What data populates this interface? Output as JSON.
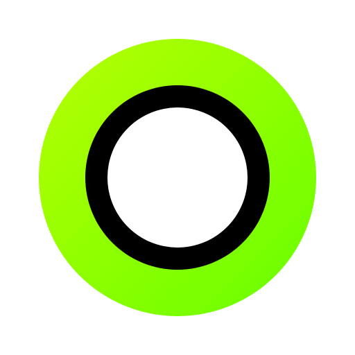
{
  "logo": {
    "icon": "ring-logo-icon",
    "colors": {
      "background": "#ffffff",
      "outer_gradient_start": "#b8ff00",
      "outer_gradient_end": "#66ff00",
      "ring": "#000000",
      "inner": "#ffffff"
    }
  }
}
